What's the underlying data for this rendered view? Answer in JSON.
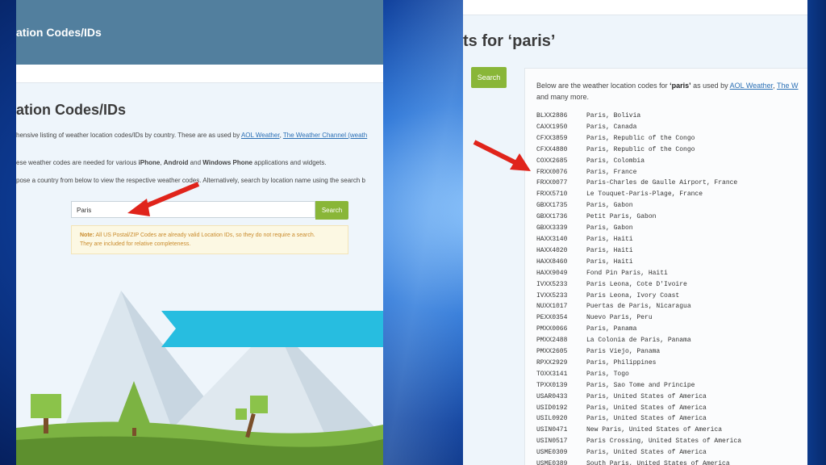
{
  "left": {
    "header_title": "ation Codes/IDs",
    "heading": "ation Codes/IDs",
    "para1_text": "hensive listing of weather location codes/IDs by country. These are as used by ",
    "para1_link1": "AOL Weather",
    "para1_sep": ", ",
    "para1_link2": "The Weather Channel (weath",
    "para2_text": "ese weather codes are needed for various ",
    "para2_b1": "iPhone",
    "para2_sep1": ", ",
    "para2_b2": "Android",
    "para2_sep2": " and ",
    "para2_b3": "Windows Phone",
    "para2_tail": " applications and widgets.",
    "para3_text": "pose a country from below to view the respective weather codes. Alternatively, search by location name using the search b",
    "search_value": "Paris",
    "search_button": "Search",
    "note_label": "Note:",
    "note_line1": " All US Postal/ZIP Codes are already valid Location IDs, so they do not require a search.",
    "note_line2": "They are included for relative completeness."
  },
  "right": {
    "heading": "ts for ‘paris’",
    "search_button": "Search",
    "intro_text": "Below are the weather location codes for ",
    "intro_query": "‘paris’",
    "intro_mid": " as used by ",
    "intro_link1": "AOL Weather",
    "intro_sep": ", ",
    "intro_link2": "The W",
    "intro_line2": "and many more.",
    "results": [
      {
        "code": "BLXX2886",
        "name": "Paris, Bolivia"
      },
      {
        "code": "CAXX1950",
        "name": "Paris, Canada"
      },
      {
        "code": "CFXX3859",
        "name": "Paris, Republic of the Congo"
      },
      {
        "code": "CFXX4880",
        "name": "Paris, Republic of the Congo"
      },
      {
        "code": "COXX2685",
        "name": "Paris, Colombia"
      },
      {
        "code": "FRXX0076",
        "name": "Paris, France"
      },
      {
        "code": "FRXX0077",
        "name": "Paris-Charles de Gaulle Airport, France"
      },
      {
        "code": "FRXX5710",
        "name": "Le Touquet-Paris-Plage, France"
      },
      {
        "code": "GBXX1735",
        "name": "Paris, Gabon"
      },
      {
        "code": "GBXX1736",
        "name": "Petit Paris, Gabon"
      },
      {
        "code": "GBXX3339",
        "name": "Paris, Gabon"
      },
      {
        "code": "HAXX3140",
        "name": "Paris, Haiti"
      },
      {
        "code": "HAXX4020",
        "name": "Paris, Haiti"
      },
      {
        "code": "HAXX8460",
        "name": "Paris, Haiti"
      },
      {
        "code": "HAXX9049",
        "name": "Fond Pin Paris, Haiti"
      },
      {
        "code": "IVXX5233",
        "name": "Paris Leona, Cote D'Ivoire"
      },
      {
        "code": "IVXX5233",
        "name": "Paris Leona, Ivory Coast"
      },
      {
        "code": "NUXX1017",
        "name": "Puertas de Paris, Nicaragua"
      },
      {
        "code": "PEXX0354",
        "name": "Nuevo Paris, Peru"
      },
      {
        "code": "PMXX0066",
        "name": "Paris, Panama"
      },
      {
        "code": "PMXX2488",
        "name": "La Colonia de Paris, Panama"
      },
      {
        "code": "PMXX2605",
        "name": "Paris Viejo, Panama"
      },
      {
        "code": "RPXX2929",
        "name": "Paris, Philippines"
      },
      {
        "code": "TOXX3141",
        "name": "Paris, Togo"
      },
      {
        "code": "TPXX0139",
        "name": "Paris, Sao Tome and Principe"
      },
      {
        "code": "USAR0433",
        "name": "Paris, United States of America"
      },
      {
        "code": "USID0192",
        "name": "Paris, United States of America"
      },
      {
        "code": "USIL0920",
        "name": "Paris, United States of America"
      },
      {
        "code": "USIN0471",
        "name": "New Paris, United States of America"
      },
      {
        "code": "USIN0517",
        "name": "Paris Crossing, United States of America"
      },
      {
        "code": "USME0309",
        "name": "Paris, United States of America"
      },
      {
        "code": "USME0389",
        "name": "South Paris, United States of America"
      }
    ]
  },
  "colors": {
    "header": "#527f9e",
    "button_green": "#89b638",
    "link_blue": "#2a6fb5",
    "arrow_red": "#e0241b",
    "banner_cyan": "#27bde0",
    "note_text": "#c98a2b",
    "note_bg": "#fcf8e3"
  },
  "icons": [
    "red-arrow-icon"
  ]
}
